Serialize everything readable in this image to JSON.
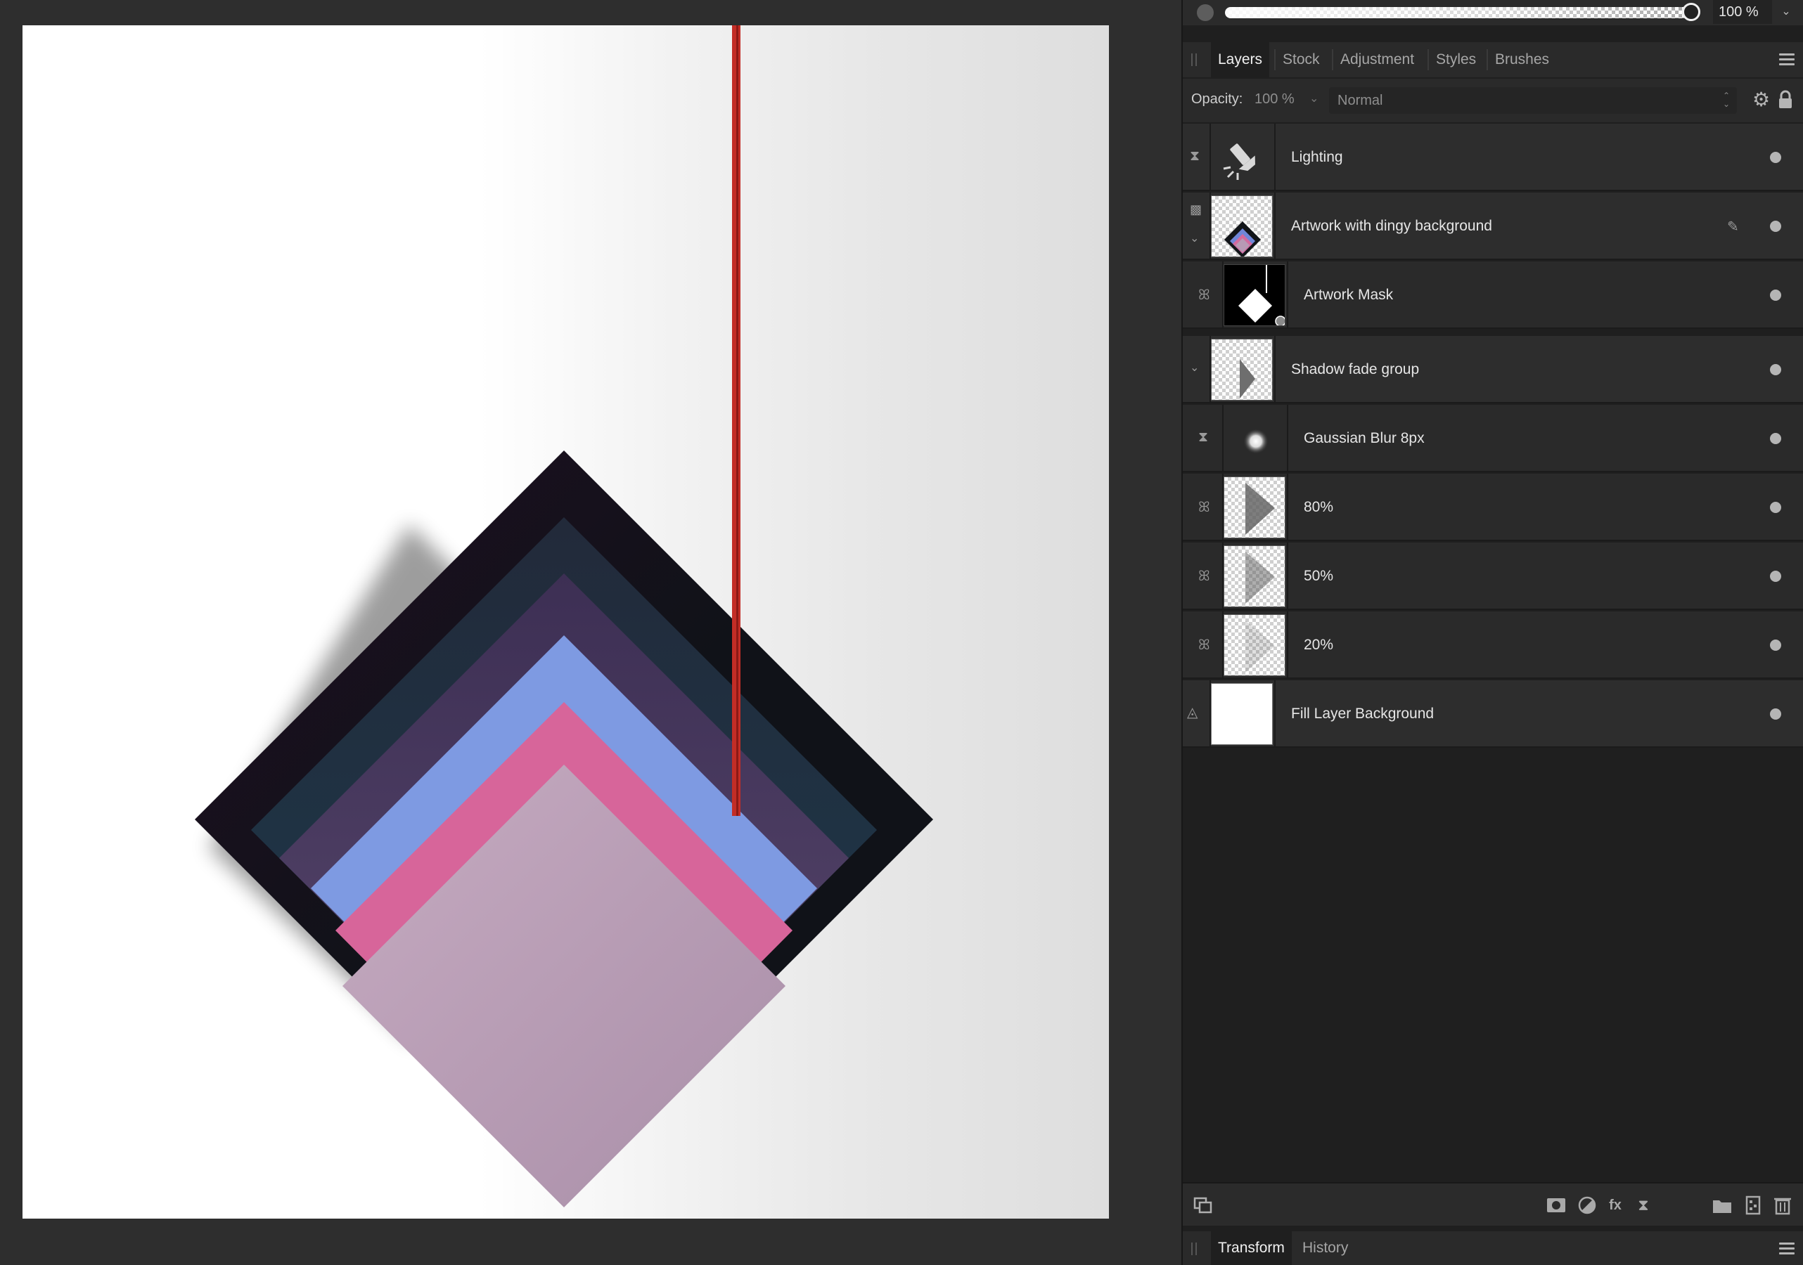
{
  "opacity_bar": {
    "value_label": "100 %",
    "level": 1.0,
    "caret": "⌄"
  },
  "panel_tabs": [
    {
      "label": "Layers",
      "active": true
    },
    {
      "label": "Stock",
      "active": false
    },
    {
      "label": "Adjustment",
      "active": false
    },
    {
      "label": "Styles",
      "active": false
    },
    {
      "label": "Brushes",
      "active": false
    }
  ],
  "layer_props": {
    "opacity_label": "Opacity:",
    "opacity_value": "100 %",
    "blend_mode": "Normal"
  },
  "layers": [
    {
      "name": "Lighting",
      "type": "live-filter",
      "icon": "lighting-icon"
    },
    {
      "name": "Artwork with dingy background",
      "type": "pixel",
      "icon": "artwork-thumbnail"
    },
    {
      "name": "Artwork Mask",
      "type": "mask",
      "icon": "mask-thumbnail"
    },
    {
      "name": "Shadow fade group",
      "type": "group",
      "icon": "group-thumbnail"
    },
    {
      "name": "Gaussian Blur 8px",
      "type": "live-filter",
      "icon": "blur-icon"
    },
    {
      "name": "80%",
      "type": "shape",
      "icon": "triangle-thumbnail"
    },
    {
      "name": "50%",
      "type": "shape",
      "icon": "triangle-thumbnail"
    },
    {
      "name": "20%",
      "type": "shape",
      "icon": "triangle-thumbnail"
    },
    {
      "name": "Fill Layer Background",
      "type": "fill",
      "icon": "fill-thumbnail"
    }
  ],
  "bottom_tabs": [
    {
      "label": "Transform",
      "active": true
    },
    {
      "label": "History",
      "active": false
    }
  ]
}
